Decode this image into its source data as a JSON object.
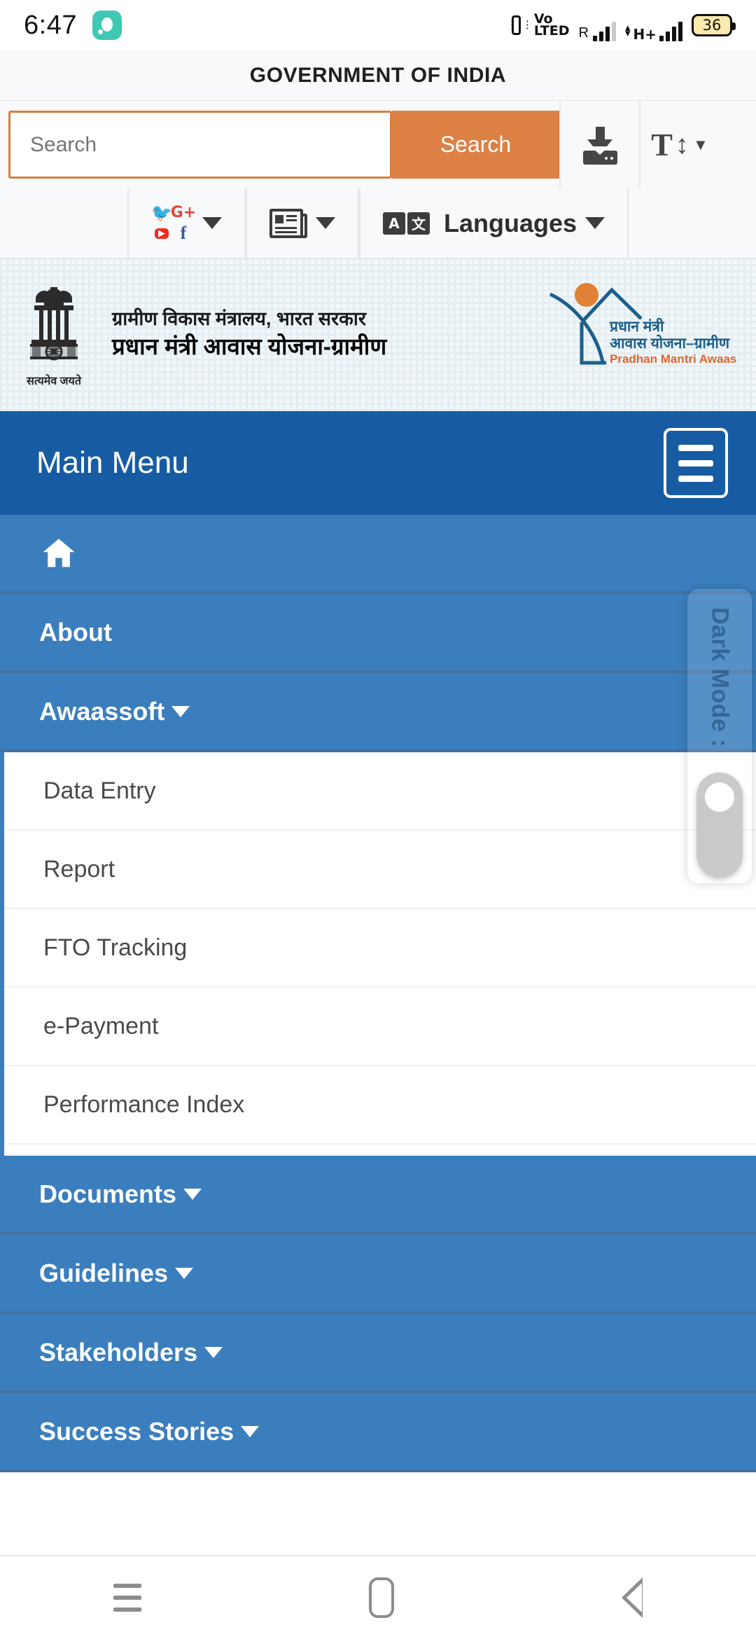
{
  "status_bar": {
    "time": "6:47",
    "app_icon": "messaging-icon",
    "vibrate_icon": "vibrate-icon",
    "volte_line1": "Vo",
    "volte_line2": "LTED",
    "roaming_label": "R",
    "network_type": "H+",
    "battery_level": "36"
  },
  "gov_header": {
    "title": "GOVERNMENT OF INDIA"
  },
  "search": {
    "placeholder": "Search",
    "button_label": "Search",
    "download_icon": "download-icon",
    "text_size_icon": "text-size-icon"
  },
  "utility_bar": {
    "social": {
      "twitter": "twitter-icon",
      "google_plus": "google-plus-icon",
      "youtube": "youtube-icon",
      "facebook": "facebook-icon",
      "twitter_glyph": "ᵗ",
      "gplus_glyph": "G+",
      "youtube_glyph": "▶",
      "facebook_glyph": "f"
    },
    "news_icon": "newspaper-icon",
    "language": {
      "icon_left": "A",
      "icon_right": "文",
      "label": "Languages"
    }
  },
  "logo_band": {
    "emblem_motto": "सत्यमेव जयते",
    "ministry_line1": "ग्रामीण विकास मंत्रालय, भारत सरकार",
    "ministry_line2": "प्रधान मंत्री आवास योजना-ग्रामीण",
    "pmay_hi_line1": "प्रधान मंत्री",
    "pmay_hi_line2": "आवास योजना–ग्रामीण",
    "pmay_en": "Pradhan Mantri Awaas Yojana-Gramin"
  },
  "main_menu": {
    "title": "Main Menu",
    "hamburger_icon": "hamburger-menu-icon",
    "items": [
      {
        "label": "",
        "icon": "home-icon",
        "has_caret": false
      },
      {
        "label": "About",
        "icon": "",
        "has_caret": false
      },
      {
        "label": "Awaassoft",
        "icon": "",
        "has_caret": true
      },
      {
        "label": "Documents",
        "icon": "",
        "has_caret": true
      },
      {
        "label": "Guidelines",
        "icon": "",
        "has_caret": true
      },
      {
        "label": "Stakeholders",
        "icon": "",
        "has_caret": true
      },
      {
        "label": "Success Stories",
        "icon": "",
        "has_caret": true
      }
    ],
    "submenu": [
      "Data Entry",
      "Report",
      "FTO Tracking",
      "e-Payment",
      "Performance Index"
    ]
  },
  "dark_mode": {
    "label": "Dark Mode :",
    "toggle_state": "off"
  },
  "navbar": {
    "recent_icon": "recent-apps-icon",
    "home_icon": "home-pill-icon",
    "back_icon": "back-triangle-icon"
  },
  "colors": {
    "accent_orange": "#dd8144",
    "header_blue": "#175ca3",
    "menu_blue": "#3a7ebd",
    "band_bg": "#f7f9fa"
  }
}
